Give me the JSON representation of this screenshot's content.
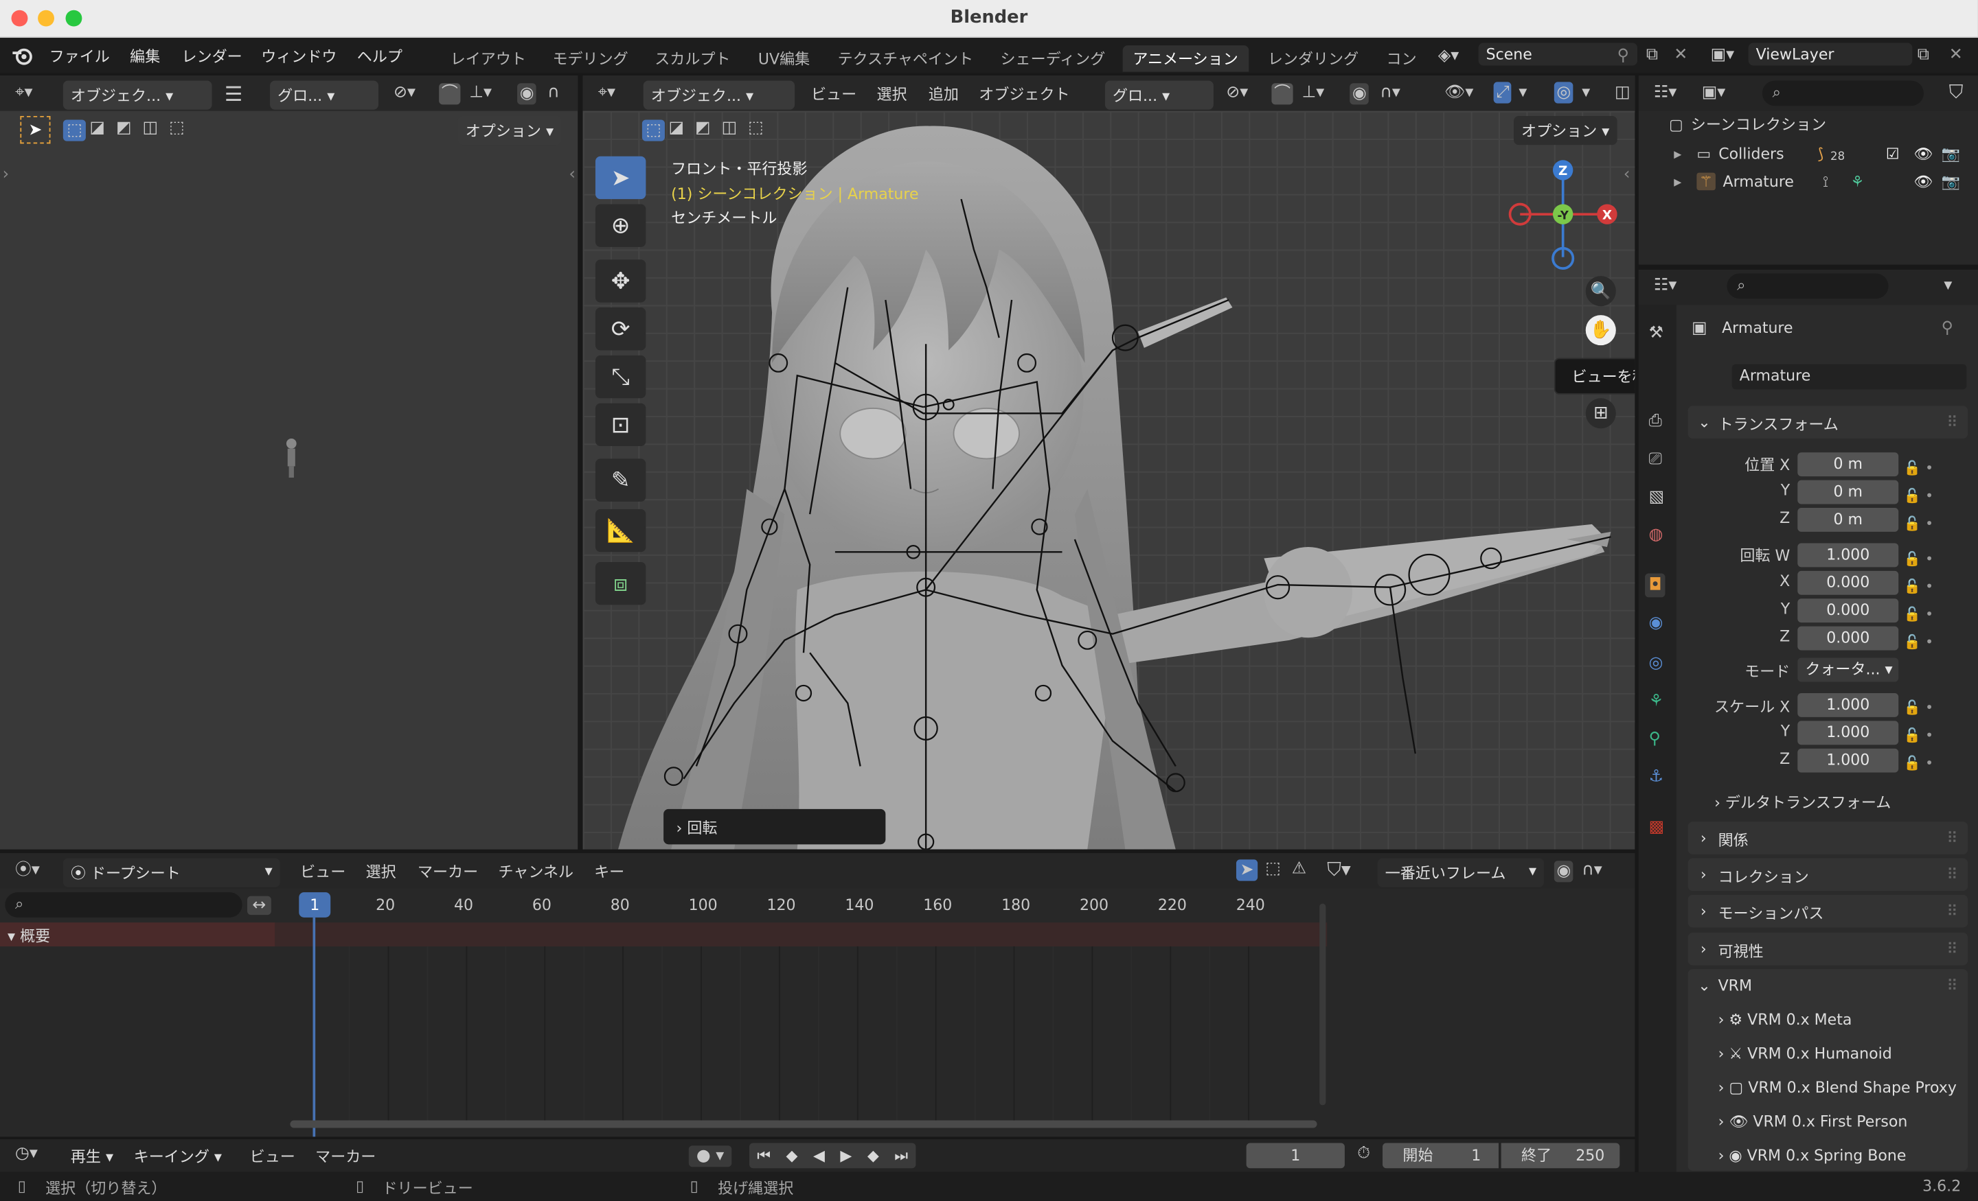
{
  "window": {
    "title": "Blender",
    "version": "3.6.2"
  },
  "menu": {
    "items": [
      "ファイル",
      "編集",
      "レンダー",
      "ウィンドウ",
      "ヘルプ"
    ]
  },
  "workspaces": {
    "tabs": [
      "レイアウト",
      "モデリング",
      "スカルプト",
      "UV編集",
      "テクスチャペイント",
      "シェーディング",
      "アニメーション",
      "レンダリング",
      "コン"
    ],
    "active": "アニメーション"
  },
  "scene": {
    "name": "Scene",
    "view_layer": "ViewLayer"
  },
  "left_viewport": {
    "mode": "オブジェク...",
    "transform": "グロ...",
    "options": "オプション"
  },
  "main_viewport": {
    "mode": "オブジェク...",
    "menus": [
      "ビュー",
      "選択",
      "追加",
      "オブジェクト"
    ],
    "transform": "グロ...",
    "options": "オプション",
    "overlay_line1": "フロント・平行投影",
    "overlay_line2": "(1) シーンコレクション | Armature",
    "overlay_line3": "センチメートル",
    "tooltip": "ビューを移動します",
    "last_op": "回転",
    "gizmo": {
      "z": "Z",
      "y": "-Y",
      "x": "X"
    }
  },
  "outliner": {
    "root": "シーンコレクション",
    "items": [
      {
        "name": "Colliders",
        "badge": "28"
      },
      {
        "name": "Armature"
      }
    ]
  },
  "properties": {
    "object_name": "Armature",
    "data_name": "Armature",
    "transform_title": "トランスフォーム",
    "location": {
      "label": "位置 X",
      "x": "0 m",
      "y": "0 m",
      "z": "0 m"
    },
    "rotation": {
      "label": "回転 W",
      "w": "1.000",
      "x": "0.000",
      "y": "0.000",
      "z": "0.000"
    },
    "mode": {
      "label": "モード",
      "value": "クォータ..."
    },
    "scale": {
      "label": "スケール X",
      "x": "1.000",
      "y": "1.000",
      "z": "1.000"
    },
    "axis": {
      "x": "X",
      "y": "Y",
      "z": "Z"
    },
    "sections": [
      "デルタトランスフォーム",
      "関係",
      "コレクション",
      "モーションパス",
      "可視性"
    ],
    "vrm": {
      "title": "VRM",
      "items": [
        "VRM 0.x Meta",
        "VRM 0.x Humanoid",
        "VRM 0.x Blend Shape Proxy",
        "VRM 0.x First Person",
        "VRM 0.x Spring Bone"
      ]
    }
  },
  "dopesheet": {
    "mode": "ドープシート",
    "menus": [
      "ビュー",
      "選択",
      "マーカー",
      "チャンネル",
      "キー"
    ],
    "snap": "一番近いフレーム",
    "summary": "概要",
    "ticks": [
      "20",
      "40",
      "60",
      "80",
      "100",
      "120",
      "140",
      "160",
      "180",
      "200",
      "220",
      "240"
    ],
    "current_frame": "1"
  },
  "timeline": {
    "menus": [
      "再生",
      "キーイング",
      "ビュー",
      "マーカー"
    ],
    "frame": "1",
    "start_label": "開始",
    "start": "1",
    "end_label": "終了",
    "end": "250"
  },
  "statusbar": {
    "items": [
      "選択（切り替え）",
      "ドリービュー",
      "投げ縄選択"
    ]
  }
}
